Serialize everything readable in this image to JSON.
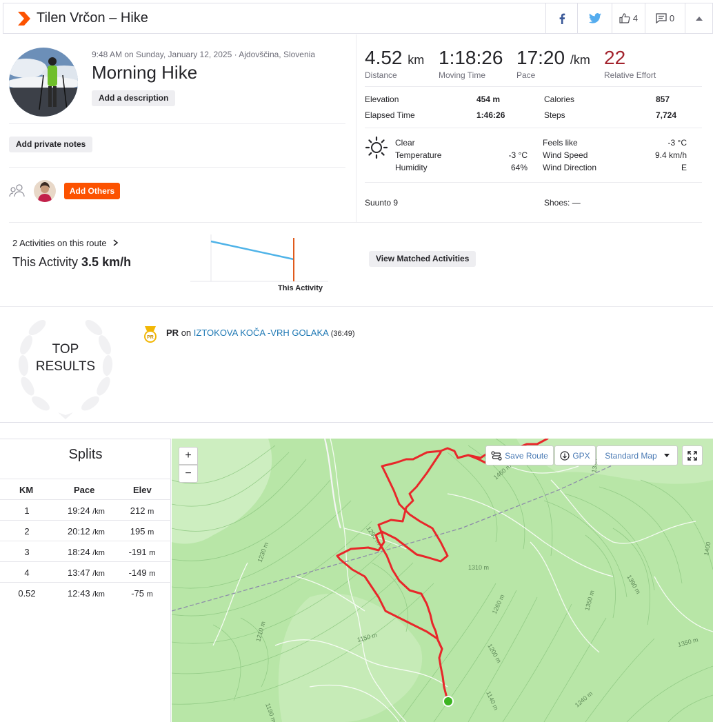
{
  "header": {
    "title": "Tilen Vrčon – Hike",
    "kudos_count": "4",
    "comment_count": "0"
  },
  "activity": {
    "meta": "9:48 AM on Sunday, January 12, 2025 · Ajdovščina, Slovenia",
    "name": "Morning Hike",
    "add_description": "Add a description",
    "add_private_notes": "Add private notes",
    "add_others": "Add Others"
  },
  "stats": {
    "distance_value": "4.52",
    "distance_unit": "km",
    "distance_label": "Distance",
    "moving_time_value": "1:18:26",
    "moving_time_label": "Moving Time",
    "pace_value": "17:20",
    "pace_unit": "/km",
    "pace_label": "Pace",
    "effort_value": "22",
    "effort_label": "Relative Effort",
    "effort_color": "#a3232d"
  },
  "details": {
    "elevation_label": "Elevation",
    "elevation_value": "454 m",
    "elapsed_label": "Elapsed Time",
    "elapsed_value": "1:46:26",
    "calories_label": "Calories",
    "calories_value": "857",
    "steps_label": "Steps",
    "steps_value": "7,724"
  },
  "weather": {
    "icon": "sun-icon",
    "condition": "Clear",
    "temperature_label": "Temperature",
    "temperature_value": "-3 °C",
    "humidity_label": "Humidity",
    "humidity_value": "64%",
    "feels_like_label": "Feels like",
    "feels_like_value": "-3 °C",
    "wind_speed_label": "Wind Speed",
    "wind_speed_value": "9.4 km/h",
    "wind_direction_label": "Wind Direction",
    "wind_direction_value": "E"
  },
  "device": "Suunto 9",
  "shoes": "Shoes: —",
  "route": {
    "count_text": "2 Activities on this route",
    "this_activity_prefix": "This Activity",
    "this_activity_speed": "3.5 km/h",
    "chart_label": "This Activity",
    "view_matched": "View Matched Activities"
  },
  "top_results": {
    "title_line1": "TOP",
    "title_line2": "RESULTS",
    "pr_badge": "PR",
    "pr_label": "PR",
    "pr_on": "on",
    "segment": "IZTOKOVA KOČA -VRH GOLAKA",
    "segment_time": "(36:49)"
  },
  "splits": {
    "title": "Splits",
    "headers": [
      "KM",
      "Pace",
      "Elev"
    ],
    "pace_unit": "/km",
    "elev_unit": "m",
    "rows": [
      {
        "km": "1",
        "pace": "19:24",
        "elev": "212"
      },
      {
        "km": "2",
        "pace": "20:12",
        "elev": "195"
      },
      {
        "km": "3",
        "pace": "18:24",
        "elev": "-191"
      },
      {
        "km": "4",
        "pace": "13:47",
        "elev": "-149"
      },
      {
        "km": "0.52",
        "pace": "12:43",
        "elev": "-75"
      }
    ]
  },
  "map": {
    "zoom_in": "+",
    "zoom_out": "−",
    "save_route": "Save Route",
    "gpx": "GPX",
    "map_type": "Standard Map",
    "contours": [
      "1460 m",
      "1390",
      "1290 m",
      "1230 m",
      "1310 m",
      "1260 m",
      "1390 m",
      "1350 m",
      "1210 m",
      "1150 m",
      "1200 m",
      "1350 m",
      "1140 m",
      "1240 m",
      "1190 m",
      "1400"
    ],
    "route_color": "#e8272a"
  }
}
